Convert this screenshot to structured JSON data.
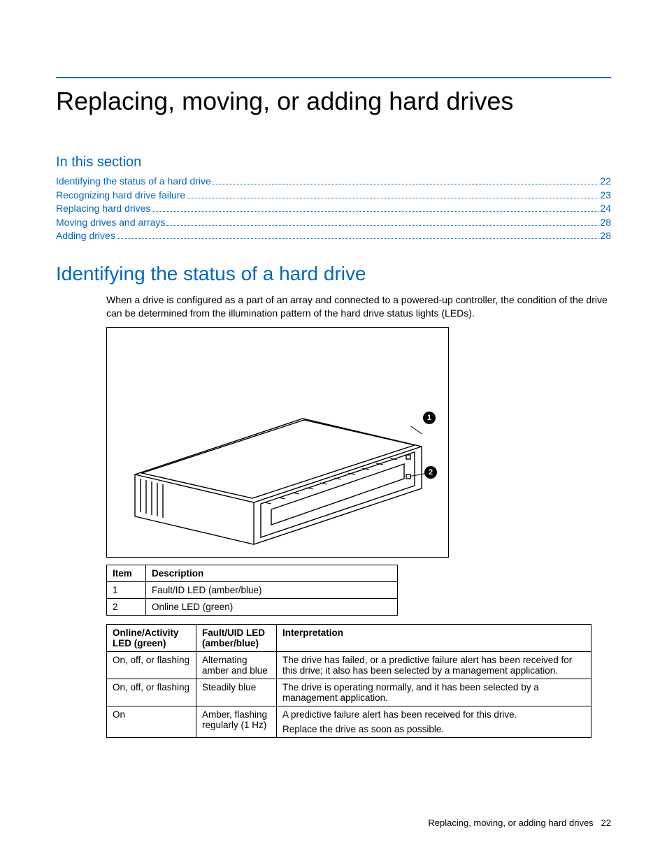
{
  "title": "Replacing, moving, or adding hard drives",
  "section_label": "In this section",
  "toc": [
    {
      "label": "Identifying the status of a hard drive",
      "page": "22"
    },
    {
      "label": "Recognizing hard drive failure",
      "page": "23"
    },
    {
      "label": "Replacing hard drives",
      "page": "24"
    },
    {
      "label": "Moving drives and arrays",
      "page": "28"
    },
    {
      "label": "Adding drives",
      "page": "28"
    }
  ],
  "subheading": "Identifying the status of a hard drive",
  "body": "When a drive is configured as a part of an array and connected to a powered-up controller, the condition of the drive can be determined from the illumination pattern of the hard drive status lights (LEDs).",
  "callouts": {
    "c1": "1",
    "c2": "2"
  },
  "table1": {
    "headers": [
      "Item",
      "Description"
    ],
    "rows": [
      [
        "1",
        "Fault/ID LED (amber/blue)"
      ],
      [
        "2",
        "Online LED (green)"
      ]
    ]
  },
  "table2": {
    "headers": [
      "Online/Activity LED (green)",
      "Fault/UID LED (amber/blue)",
      "Interpretation"
    ],
    "rows": [
      {
        "c0": "On, off, or flashing",
        "c1": "Alternating amber and blue",
        "c2": [
          "The drive has failed, or a predictive failure alert has been received for this drive; it also has been selected by a management application."
        ]
      },
      {
        "c0": "On, off, or flashing",
        "c1": "Steadily blue",
        "c2": [
          "The drive is operating normally, and it has been selected by a management application."
        ]
      },
      {
        "c0": "On",
        "c1": "Amber, flashing regularly (1 Hz)",
        "c2": [
          "A predictive failure alert has been received for this drive.",
          "Replace the drive as soon as possible."
        ]
      }
    ]
  },
  "footer": {
    "text": "Replacing, moving, or adding hard drives",
    "page": "22"
  }
}
